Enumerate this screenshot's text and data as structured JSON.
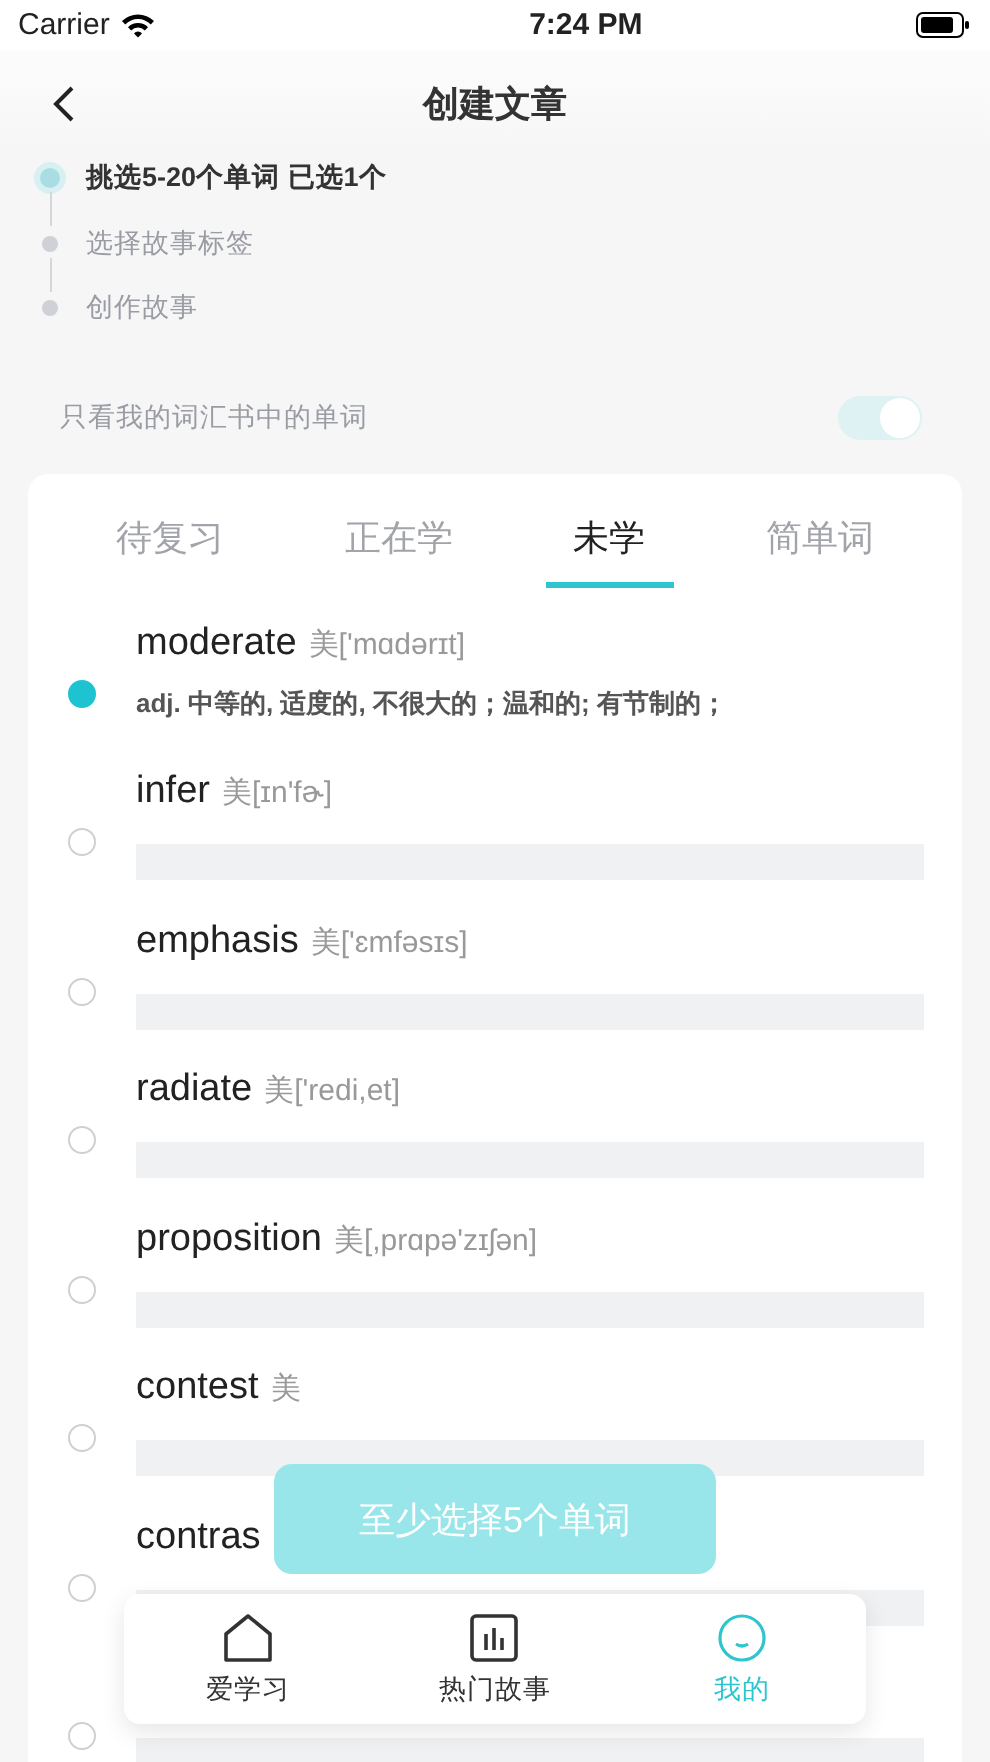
{
  "status_bar": {
    "carrier": "Carrier",
    "time": "7:24 PM"
  },
  "nav": {
    "title": "创建文章"
  },
  "steps": [
    {
      "label": "挑选5-20个单词 已选1个",
      "active": true
    },
    {
      "label": "选择故事标签",
      "active": false
    },
    {
      "label": "创作故事",
      "active": false
    }
  ],
  "filter": {
    "label": "只看我的词汇书中的单词",
    "on": true
  },
  "tabs": [
    {
      "label": "待复习",
      "selected": false
    },
    {
      "label": "正在学",
      "selected": false
    },
    {
      "label": "未学",
      "selected": true
    },
    {
      "label": "简单词",
      "selected": false
    }
  ],
  "words": [
    {
      "word": "moderate",
      "phonetic": "美['mɑdərɪt]",
      "definition": "adj. 中等的, 适度的, 不很大的；温和的; 有节制的；",
      "selected": true
    },
    {
      "word": "infer",
      "phonetic": "美[ɪn'fɚ]",
      "selected": false
    },
    {
      "word": "emphasis",
      "phonetic": "美['ɛmfəsɪs]",
      "selected": false
    },
    {
      "word": "radiate",
      "phonetic": "美['redi,et]",
      "selected": false
    },
    {
      "word": "proposition",
      "phonetic": "美[,prɑpə'zɪʃən]",
      "selected": false
    },
    {
      "word": "contest",
      "phonetic": "美",
      "selected": false
    },
    {
      "word": "contras",
      "selected": false
    },
    {
      "selected": false
    }
  ],
  "toast": "至少选择5个单词",
  "tab_bar": [
    {
      "label": "爱学习",
      "kind": "home",
      "selected": false
    },
    {
      "label": "热门故事",
      "kind": "chart",
      "selected": false
    },
    {
      "label": "我的",
      "kind": "smile",
      "selected": true
    }
  ]
}
